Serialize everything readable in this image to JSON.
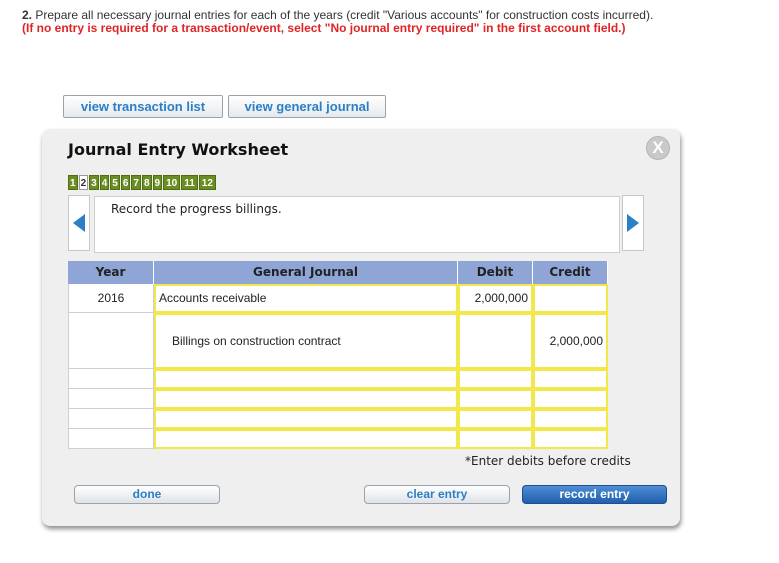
{
  "instructions": {
    "number": "2.",
    "text": "Prepare all necessary journal entries for each of the years (credit \"Various accounts\" for construction costs incurred).",
    "warning": "(If no entry is required for a transaction/event, select \"No journal entry required\" in the first account field.)"
  },
  "top_buttons": {
    "transaction_list": "view transaction list",
    "general_journal": "view general journal"
  },
  "worksheet": {
    "title": "Journal Entry Worksheet",
    "close_label": "X",
    "tabs": [
      "1",
      "2",
      "3",
      "4",
      "5",
      "6",
      "7",
      "8",
      "9",
      "10",
      "11",
      "12"
    ],
    "active_tab": "2",
    "description": "Record the progress billings.",
    "columns": {
      "year": "Year",
      "journal": "General Journal",
      "debit": "Debit",
      "credit": "Credit"
    },
    "rows": [
      {
        "year": "2016",
        "account": "Accounts receivable",
        "debit": "2,000,000",
        "credit": ""
      },
      {
        "year": "",
        "account": "Billings on construction contract",
        "debit": "",
        "credit": "2,000,000"
      },
      {
        "year": "",
        "account": "",
        "debit": "",
        "credit": ""
      },
      {
        "year": "",
        "account": "",
        "debit": "",
        "credit": ""
      },
      {
        "year": "",
        "account": "",
        "debit": "",
        "credit": ""
      },
      {
        "year": "",
        "account": "",
        "debit": "",
        "credit": ""
      }
    ],
    "note": "*Enter debits before credits"
  },
  "bottom_buttons": {
    "done": "done",
    "clear": "clear entry",
    "record": "record entry"
  },
  "colors": {
    "tab_green": "#6b8e23",
    "header_blue": "#8fa5d6",
    "input_yellow": "#f2e84a",
    "warning_red": "#e02424",
    "link_blue": "#2a7fc7"
  }
}
